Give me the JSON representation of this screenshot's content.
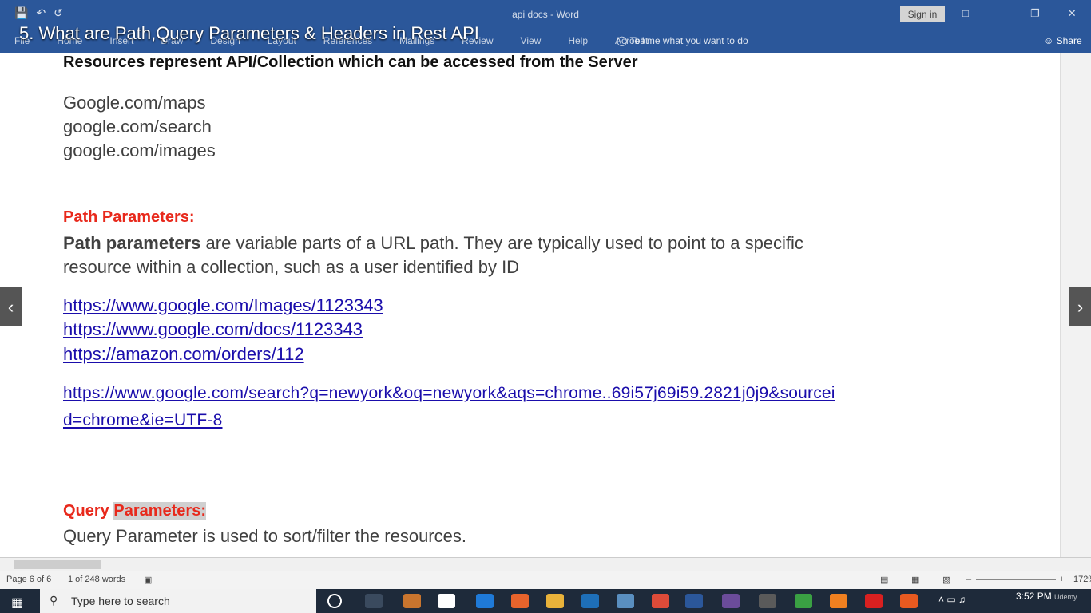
{
  "window": {
    "doc_title": "api docs - Word",
    "sign_in": "Sign in"
  },
  "ribbon": {
    "tabs": [
      "File",
      "Home",
      "Insert",
      "Draw",
      "Design",
      "Layout",
      "References",
      "Mailings",
      "Review",
      "View",
      "Help",
      "Acrobat"
    ],
    "tell_me": "Tell me what you want to do",
    "share": "Share"
  },
  "overlay_title": "5. What are Path,Query Parameters & Headers in Rest API",
  "document": {
    "heading": "Resources represent API/Collection which can be accessed from the Server",
    "resources": [
      "Google.com/maps",
      "google.com/search",
      "google.com/images"
    ],
    "path_heading": "Path Parameters:",
    "path_bold": "Path parameters",
    "path_desc_1": " are variable parts of a URL path. They are typically used to point to a specific",
    "path_desc_2": "resource within a collection, such as a user identified by ID",
    "path_links": [
      "https://www.google.com/Images/1123343",
      "https://www.google.com/docs/1123343",
      "https://amazon.com/orders/112"
    ],
    "query_link_1": "https://www.google.com/search?q=newyork&oq=newyork&aqs=chrome..69i57j69i59.2821j0j9&sourcei",
    "query_link_2": "d=chrome&ie=UTF-8",
    "query_heading_a": "Query ",
    "query_heading_b": "Parameters",
    "query_heading_c": ":",
    "query_desc": "Query Parameter is used to sort/filter the resources."
  },
  "status": {
    "page": "Page 6 of 6",
    "words": "1 of 248 words",
    "zoom": "172%"
  },
  "taskbar": {
    "search_placeholder": "Type here to search",
    "time": "3:52 PM",
    "watermark": "Udemy"
  }
}
